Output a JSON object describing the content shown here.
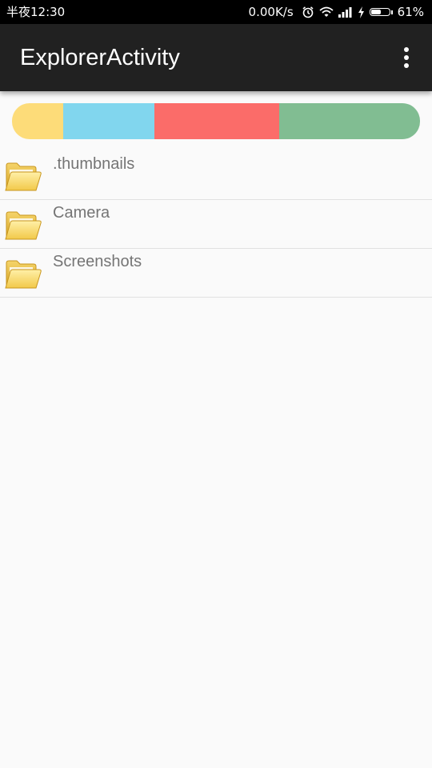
{
  "status_bar": {
    "time": "半夜12:30",
    "network_speed": "0.00K/s",
    "battery_percent": "61%",
    "battery_level": 0.61,
    "icons": [
      "alarm-icon",
      "wifi-icon",
      "signal-icon",
      "charging-icon",
      "battery-icon"
    ]
  },
  "action_bar": {
    "title": "ExplorerActivity",
    "overflow_icon": "more-vert-icon"
  },
  "storage_bar": {
    "segments": [
      {
        "name": "segment-1",
        "color": "#fddc79",
        "fraction": 0.126
      },
      {
        "name": "segment-2",
        "color": "#81d6ee",
        "fraction": 0.224
      },
      {
        "name": "segment-3",
        "color": "#fb6c69",
        "fraction": 0.304
      },
      {
        "name": "segment-4",
        "color": "#81bd92",
        "fraction": 0.346
      }
    ]
  },
  "file_list": {
    "items": [
      {
        "name": ".thumbnails",
        "icon": "folder-icon"
      },
      {
        "name": "Camera",
        "icon": "folder-icon"
      },
      {
        "name": "Screenshots",
        "icon": "folder-icon"
      }
    ]
  }
}
